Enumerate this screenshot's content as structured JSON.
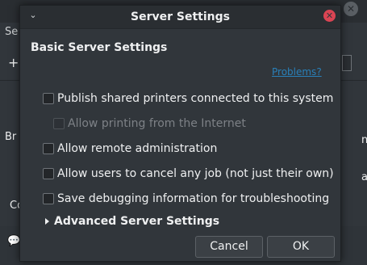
{
  "background": {
    "menu_text": "Se",
    "plus_icon": "plus-icon",
    "close_icon": "close-icon",
    "side_left_1": "Br",
    "side_left_2": "Co",
    "side_right_1": "nn",
    "side_right_2": "a"
  },
  "dialog": {
    "title": "Server Settings",
    "menu_icon": "chevron-down-icon",
    "close_icon": "close-icon",
    "section_heading": "Basic Server Settings",
    "problems_link": "Problems?",
    "options": [
      {
        "label": "Publish shared printers connected to this system",
        "checked": false,
        "enabled": true
      },
      {
        "label": "Allow printing from the Internet",
        "checked": false,
        "enabled": false
      },
      {
        "label": "Allow remote administration",
        "checked": false,
        "enabled": true
      },
      {
        "label": "Allow users to cancel any job (not just their own)",
        "checked": false,
        "enabled": true
      },
      {
        "label": "Save debugging information for troubleshooting",
        "checked": false,
        "enabled": true
      }
    ],
    "advanced_label": "Advanced Server Settings",
    "cancel_label": "Cancel",
    "ok_label": "OK"
  },
  "colors": {
    "link": "#2980b9",
    "close_button": "#da4453",
    "background": "#31363b"
  }
}
